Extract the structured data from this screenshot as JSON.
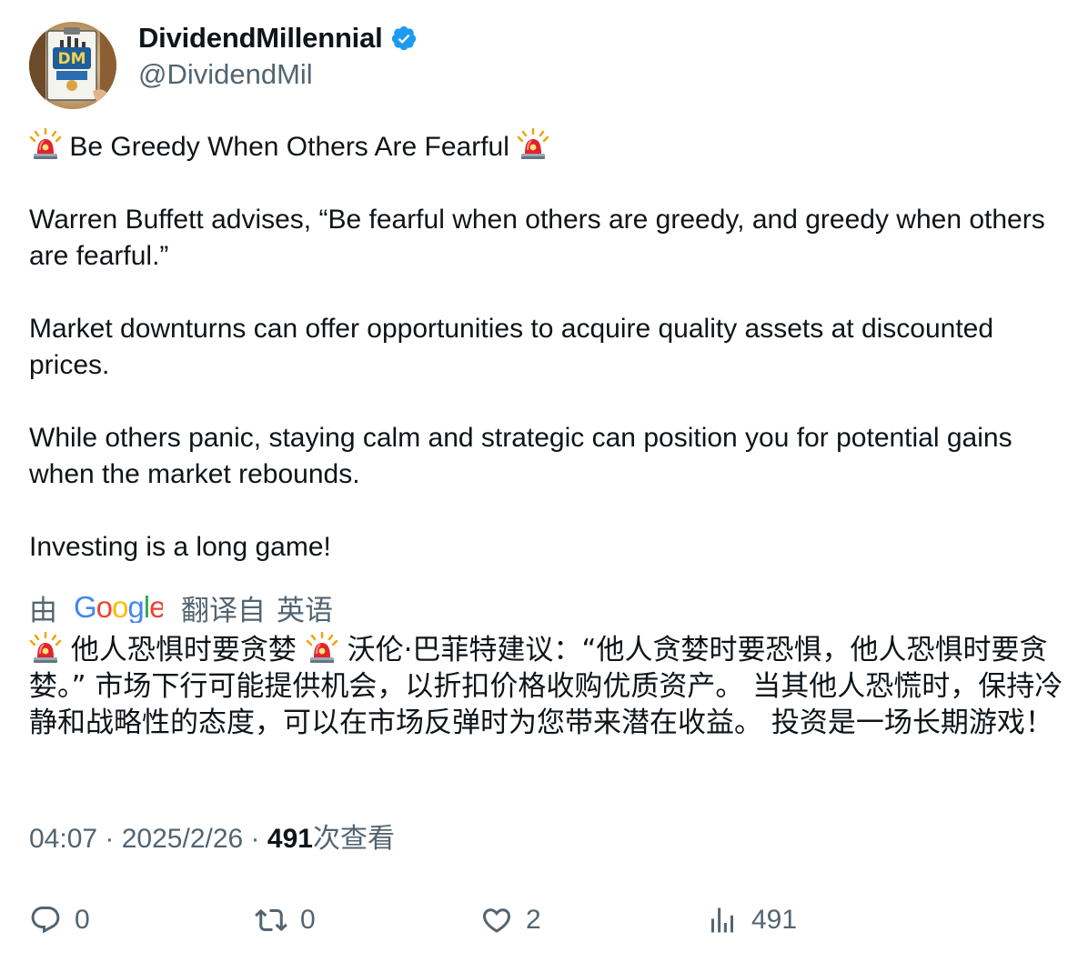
{
  "author": {
    "display_name": "DividendMillennial",
    "handle": "@DividendMil",
    "avatar_monogram": "DM",
    "verified_color": "#1d9bf0"
  },
  "tweet": {
    "headline_text": " Be Greedy When Others Are Fearful ",
    "paragraphs": [
      "Warren Buffett advises, “Be fearful when others are greedy, and greedy when others are fearful.”",
      "Market downturns can offer opportunities to acquire quality assets at discounted prices.",
      "While others panic, staying calm and strategic can position you for potential gains when the market rebounds.",
      "Investing is a long game!"
    ]
  },
  "translation_banner": {
    "prefix": "由",
    "provider": "Google",
    "middle": "翻译自",
    "source_language": "英语"
  },
  "translation": {
    "seg1": " 他人恐惧时要贪婪 ",
    "seg2": " 沃伦·巴菲特建议：“他人贪婪时要恐惧，他人恐惧时要贪婪。” 市场下行可能提供机会，以折扣价格收购优质资产。 当其他人恐慌时，保持冷静和战略性的态度，可以在市场反弹时为您带来潜在收益。 投资是一场长期游戏！"
  },
  "meta": {
    "time": "04:07",
    "date": "2025/2/26",
    "separator": " · ",
    "views_count": "491",
    "views_label": "次查看"
  },
  "actions": {
    "reply_count": "0",
    "retweet_count": "0",
    "like_count": "2",
    "views_count": "491"
  },
  "colors": {
    "text_primary": "#0f1419",
    "text_secondary": "#536471",
    "siren_red": "#e0242b"
  }
}
